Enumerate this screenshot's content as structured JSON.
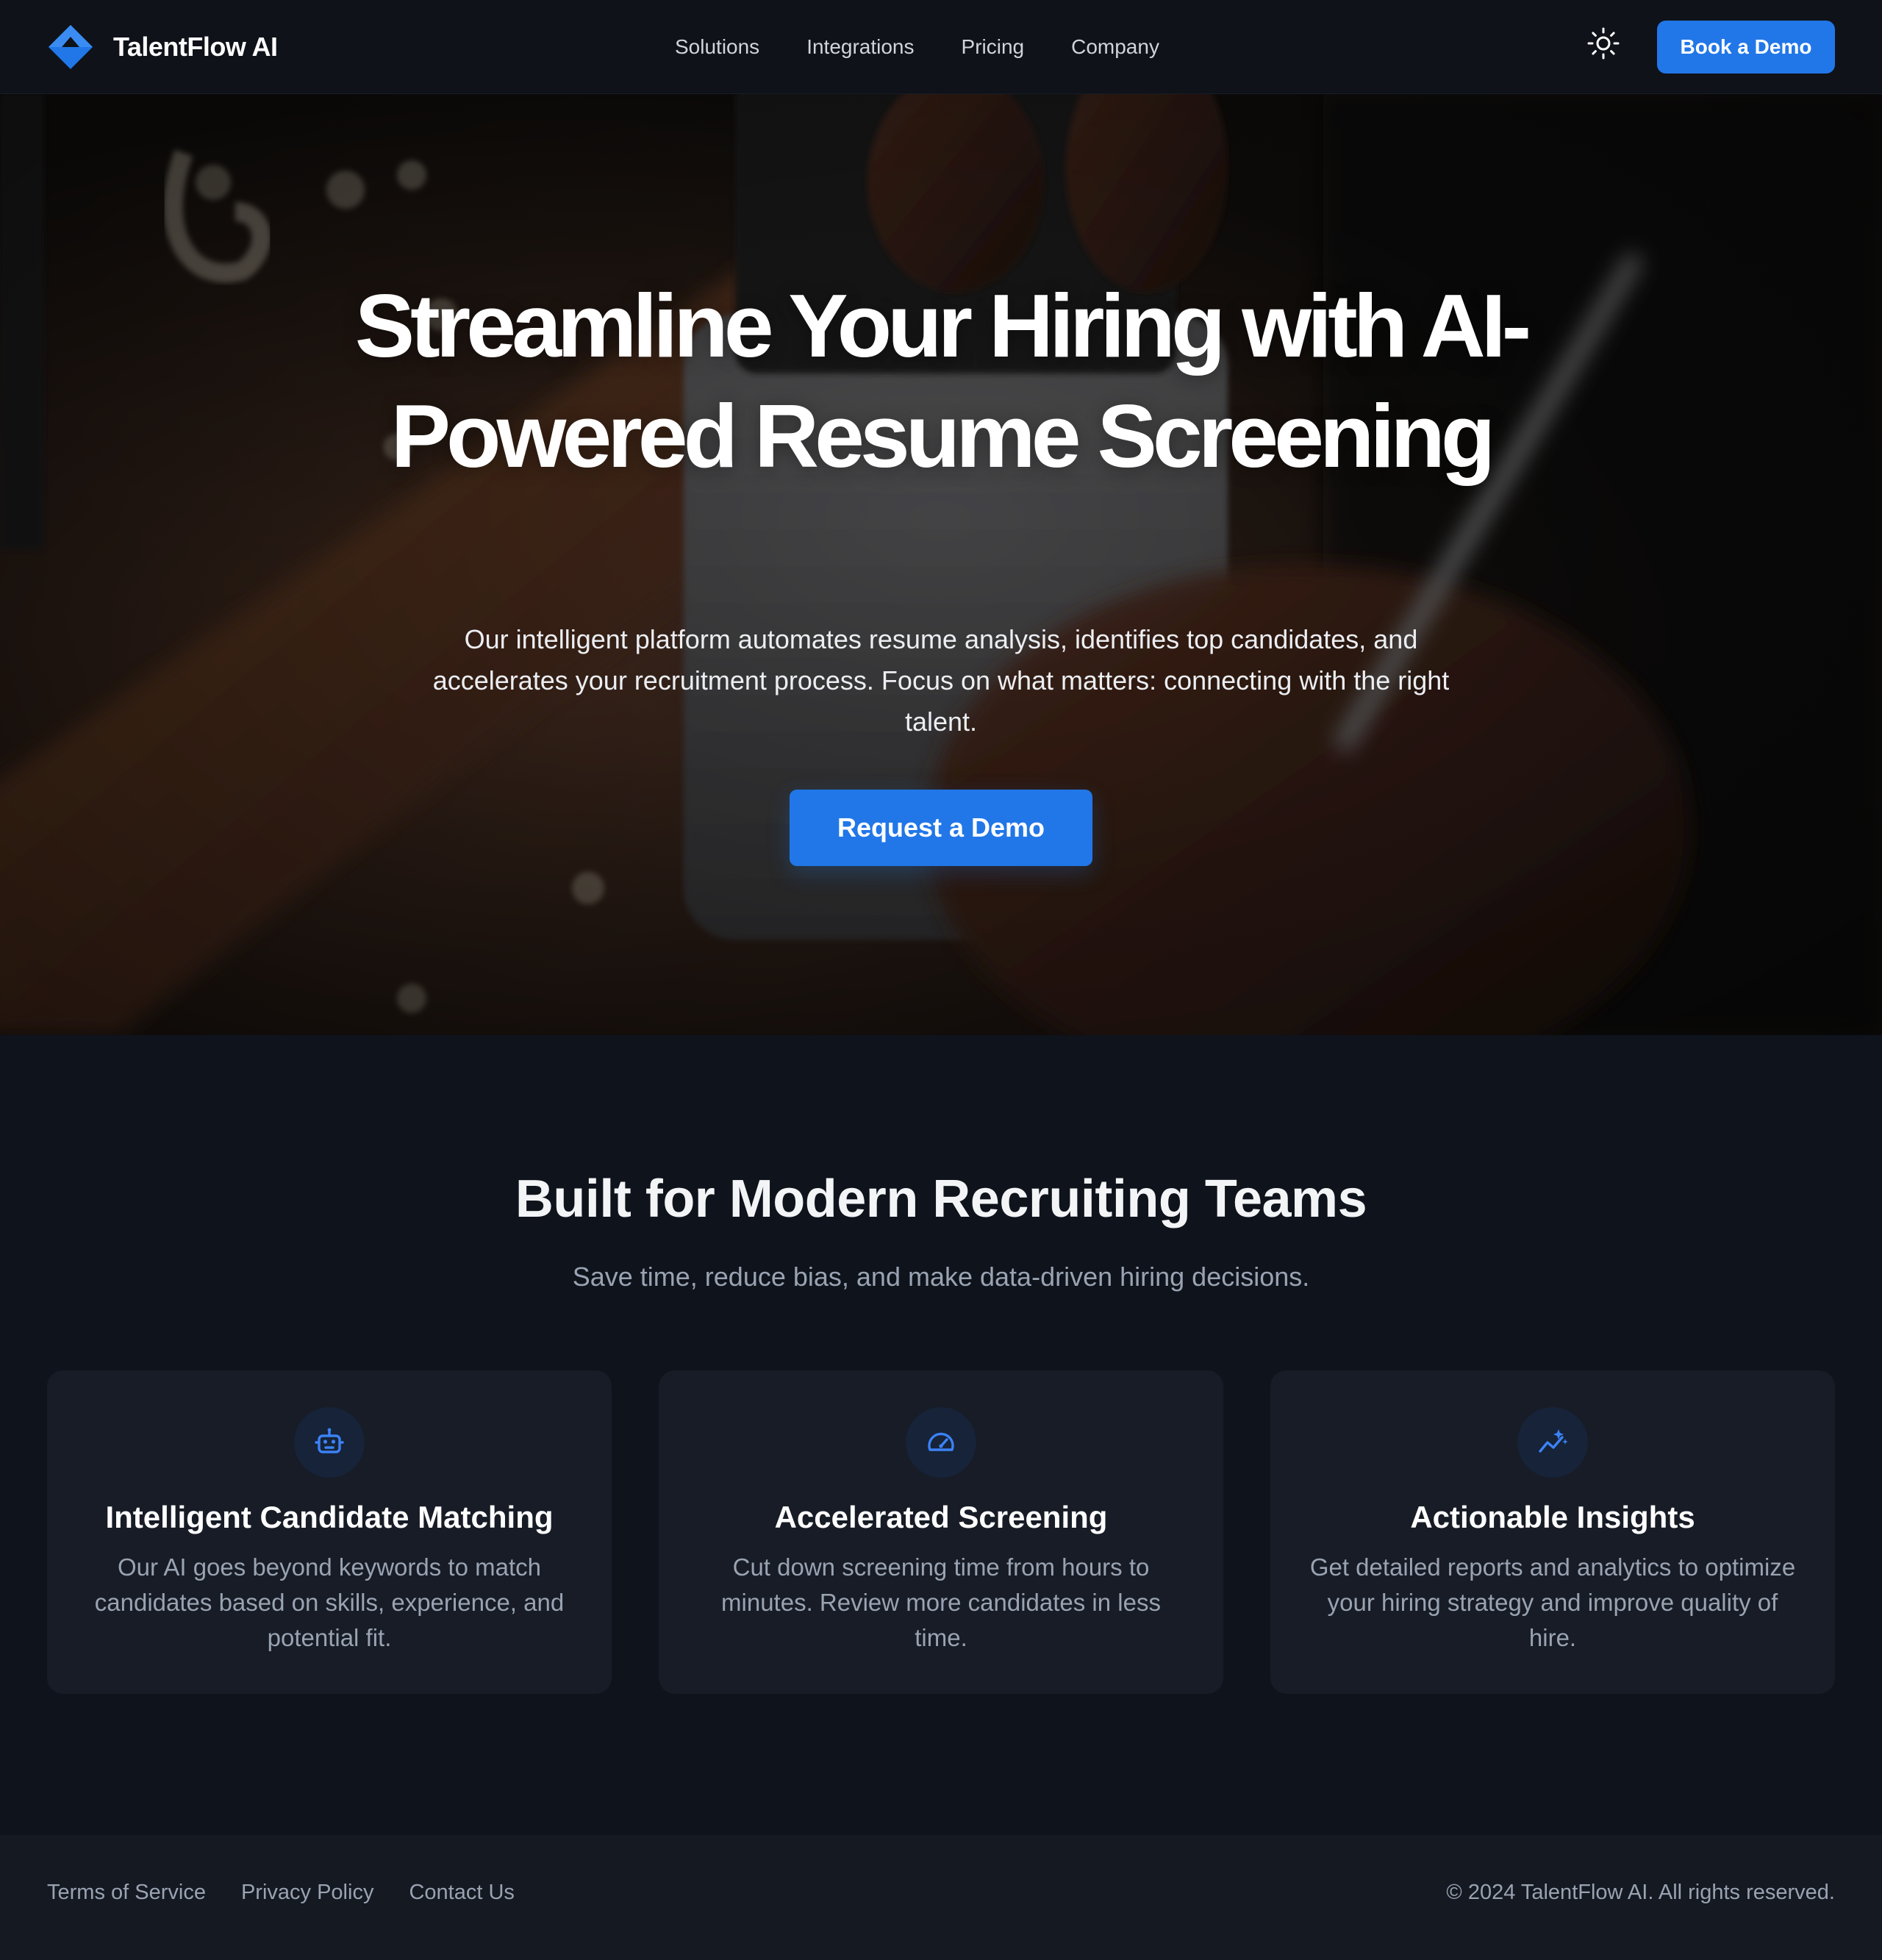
{
  "brand": {
    "name": "TalentFlow AI",
    "accent": "#2177e8"
  },
  "nav": {
    "links": [
      "Solutions",
      "Integrations",
      "Pricing",
      "Company"
    ],
    "theme_toggle_icon": "sun-icon",
    "cta_label": "Book a Demo"
  },
  "hero": {
    "title": "Streamline Your Hiring with AI-Powered Resume Screening",
    "subtitle": "Our intelligent platform automates resume analysis, identifies top candidates, and accelerates your recruitment process. Focus on what matters: connecting with the right talent.",
    "cta_label": "Request a Demo"
  },
  "features": {
    "title": "Built for Modern Recruiting Teams",
    "subtitle": "Save time, reduce bias, and make data-driven hiring decisions.",
    "cards": [
      {
        "icon": "robot-icon",
        "title": "Intelligent Candidate Matching",
        "text": "Our AI goes beyond keywords to match candidates based on skills, experience, and potential fit."
      },
      {
        "icon": "speedometer-icon",
        "title": "Accelerated Screening",
        "text": "Cut down screening time from hours to minutes. Review more candidates in less time."
      },
      {
        "icon": "trend-sparkle-icon",
        "title": "Actionable Insights",
        "text": "Get detailed reports and analytics to optimize your hiring strategy and improve quality of hire."
      }
    ]
  },
  "footer": {
    "links": [
      "Terms of Service",
      "Privacy Policy",
      "Contact Us"
    ],
    "copyright": "© 2024 TalentFlow AI. All rights reserved."
  }
}
